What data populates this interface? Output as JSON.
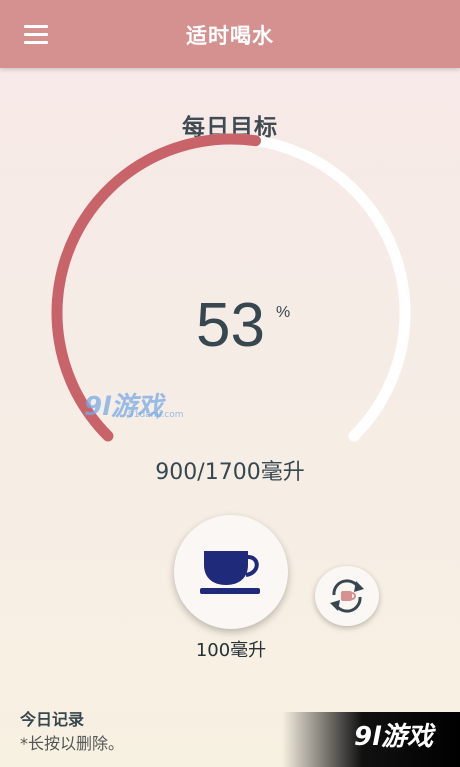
{
  "header": {
    "title": "适时喝水",
    "menu_icon": "menu-icon"
  },
  "goal": {
    "title": "每日目标",
    "percent": "53",
    "percent_sign": "%",
    "progress_fraction": 0.53,
    "amount_text": "900/1700毫升",
    "colors": {
      "progress": "#c8636a",
      "track": "#ffffff"
    }
  },
  "drink": {
    "icon": "cup-icon",
    "label": "100毫升",
    "cup_color": "#1f2a7a"
  },
  "refresh": {
    "icon": "refresh-cup-icon"
  },
  "records": {
    "title": "今日记录",
    "hint": "*长按以删除。"
  },
  "watermark": {
    "main": "9l游戏",
    "url": "91danji.com",
    "corner": "9l游戏"
  }
}
